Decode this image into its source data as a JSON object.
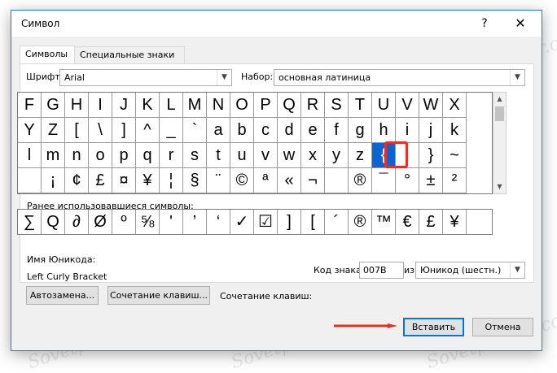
{
  "window": {
    "title": "Символ",
    "help_label": "?",
    "close_label": "✕"
  },
  "tabs": [
    {
      "label": "Символы",
      "active": true
    },
    {
      "label": "Специальные знаки",
      "active": false
    }
  ],
  "font_label": "Шрифт:",
  "font_value": "Arial",
  "subset_label": "Набор:",
  "subset_value": "основная латиница",
  "symbol_grid": [
    [
      "F",
      "G",
      "H",
      "I",
      "J",
      "K",
      "L",
      "M",
      "N",
      "O",
      "P",
      "Q",
      "R",
      "S",
      "T",
      "U",
      "V",
      "W",
      "X"
    ],
    [
      "Y",
      "Z",
      "[",
      "\\",
      "]",
      "^",
      "_",
      "`",
      "a",
      "b",
      "c",
      "d",
      "e",
      "f",
      "g",
      "h",
      "i",
      "j",
      "k"
    ],
    [
      "l",
      "m",
      "n",
      "o",
      "p",
      "q",
      "r",
      "s",
      "t",
      "u",
      "v",
      "w",
      "x",
      "y",
      "z",
      "{",
      "|",
      "}",
      "~"
    ],
    [
      "",
      "¡",
      "¢",
      "£",
      "¤",
      "¥",
      "¦",
      "§",
      "¨",
      "©",
      "ª",
      "«",
      "¬",
      "",
      "®",
      "¯",
      "°",
      "±",
      "²"
    ]
  ],
  "selected_symbol": "{",
  "recent_label": "Ранее использовавшиеся символы:",
  "recent_symbols": [
    "∑",
    "Q",
    "∂",
    "Ø",
    "º",
    "⅝",
    "'",
    "’",
    "‘",
    "✓",
    "☑",
    "]",
    "[",
    "´",
    "®",
    "™",
    "€",
    "£",
    "¥"
  ],
  "unicode_name_label": "Имя Юникода:",
  "unicode_name_value": "Left Curly Bracket",
  "char_code_label": "Код знака:",
  "char_code_value": "007B",
  "from_label": "из:",
  "from_value": "Юникод (шестн.)",
  "autocorrect_label": "Автозамена...",
  "shortcut_key_label": "Сочетание клавиш...",
  "shortcut_text": "Сочетание клавиш:",
  "insert_label": "Вставить",
  "cancel_label": "Отмена",
  "watermark": "Sovetpersoir.com",
  "colors": {
    "accent": "#0078d7",
    "selection": "#0a64d6",
    "highlight": "#e0312a"
  }
}
